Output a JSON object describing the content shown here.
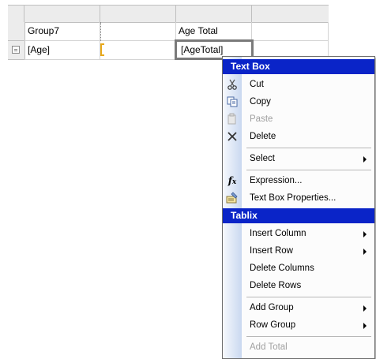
{
  "grid": {
    "group_header": "Group7",
    "total_header": "Age Total",
    "detail_age": "[Age]",
    "detail_total": "[AgeTotal]"
  },
  "menu": {
    "textbox_section": "Text Box",
    "cut": "Cut",
    "copy": "Copy",
    "paste": "Paste",
    "delete": "Delete",
    "select": "Select",
    "expression": "Expression...",
    "textbox_properties": "Text Box Properties...",
    "tablix_section": "Tablix",
    "insert_column": "Insert Column",
    "insert_row": "Insert Row",
    "delete_columns": "Delete Columns",
    "delete_rows": "Delete Rows",
    "add_group": "Add Group",
    "row_group": "Row Group",
    "add_total": "Add Total"
  },
  "colors": {
    "section_header": "#0a24c8",
    "selection_border": "#7a7a7a",
    "group_bracket": "#e8a81a",
    "disabled_text": "#a0a0a0"
  },
  "icons": {
    "cut": "scissors-icon",
    "copy": "copy-icon",
    "paste": "paste-icon",
    "delete": "delete-x-icon",
    "expression": "fx-icon",
    "properties": "properties-icon",
    "row_handle": "row-handle-icon"
  }
}
